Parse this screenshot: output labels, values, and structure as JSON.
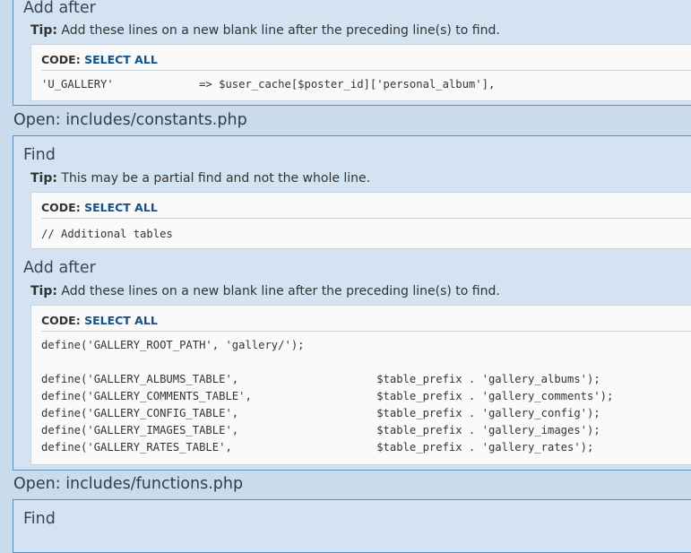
{
  "top_block": {
    "title": "Add after",
    "tip_label": "Tip:",
    "tip_text": "Add these lines on a new blank line after the preceding line(s) to find.",
    "code_label": "CODE:",
    "select_all": "SELECT ALL",
    "code_lines": [
      "'U_GALLERY'             => $user_cache[$poster_id]['personal_album'],"
    ]
  },
  "open_constants": "Open: includes/constants.php",
  "find_block": {
    "title": "Find",
    "tip_label": "Tip:",
    "tip_text": "This may be a partial find and not the whole line.",
    "code_label": "CODE:",
    "select_all": "SELECT ALL",
    "code_lines": [
      "// Additional tables"
    ]
  },
  "add_after_block": {
    "title": "Add after",
    "tip_label": "Tip:",
    "tip_text": "Add these lines on a new blank line after the preceding line(s) to find.",
    "code_label": "CODE:",
    "select_all": "SELECT ALL",
    "code_lines": [
      "define('GALLERY_ROOT_PATH', 'gallery/');",
      "",
      "define('GALLERY_ALBUMS_TABLE',                     $table_prefix . 'gallery_albums');",
      "define('GALLERY_COMMENTS_TABLE',                   $table_prefix . 'gallery_comments');",
      "define('GALLERY_CONFIG_TABLE',                     $table_prefix . 'gallery_config');",
      "define('GALLERY_IMAGES_TABLE',                     $table_prefix . 'gallery_images');",
      "define('GALLERY_RATES_TABLE',                      $table_prefix . 'gallery_rates');"
    ]
  },
  "open_functions": "Open: includes/functions.php",
  "bottom_block": {
    "title": "Find"
  }
}
